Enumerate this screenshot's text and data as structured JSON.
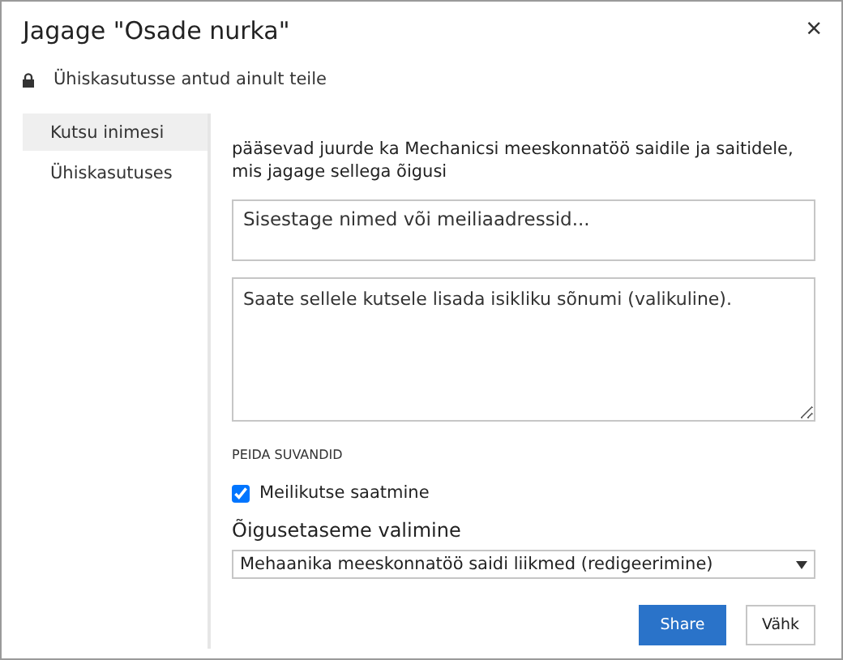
{
  "dialog": {
    "title": "Jagage \"Osade nurka\"",
    "close": "×",
    "sharing_status": "Ühiskasutusse antud ainult teile"
  },
  "nav": [
    {
      "label": "Kutsu inimesi",
      "selected": true
    },
    {
      "label": "Ühiskasutuses",
      "selected": false
    }
  ],
  "invite": {
    "description": "pääsevad juurde ka Mechanicsi meeskonnatöö saidile ja saitidele, mis jagage sellega õigusi",
    "names_field": {
      "placeholder": "Sisestage nimed või meiliaadressid..."
    },
    "message_field": {
      "placeholder": "Saate sellele kutsele lisada isikliku sõnumi (valikuline)."
    },
    "hide_options": "PEIDA SUVANDID",
    "email_invite": {
      "label": "Meilikutse saatmine",
      "checked": true
    },
    "permission_label": "Õigusetaseme valimine",
    "permission_value": "Mehaanika meeskonnatöö saidi liikmed (redigeerimine)"
  },
  "buttons": [
    {
      "label": "Share",
      "kind": "primary"
    },
    {
      "label": "Vähk",
      "kind": "secondary"
    }
  ]
}
